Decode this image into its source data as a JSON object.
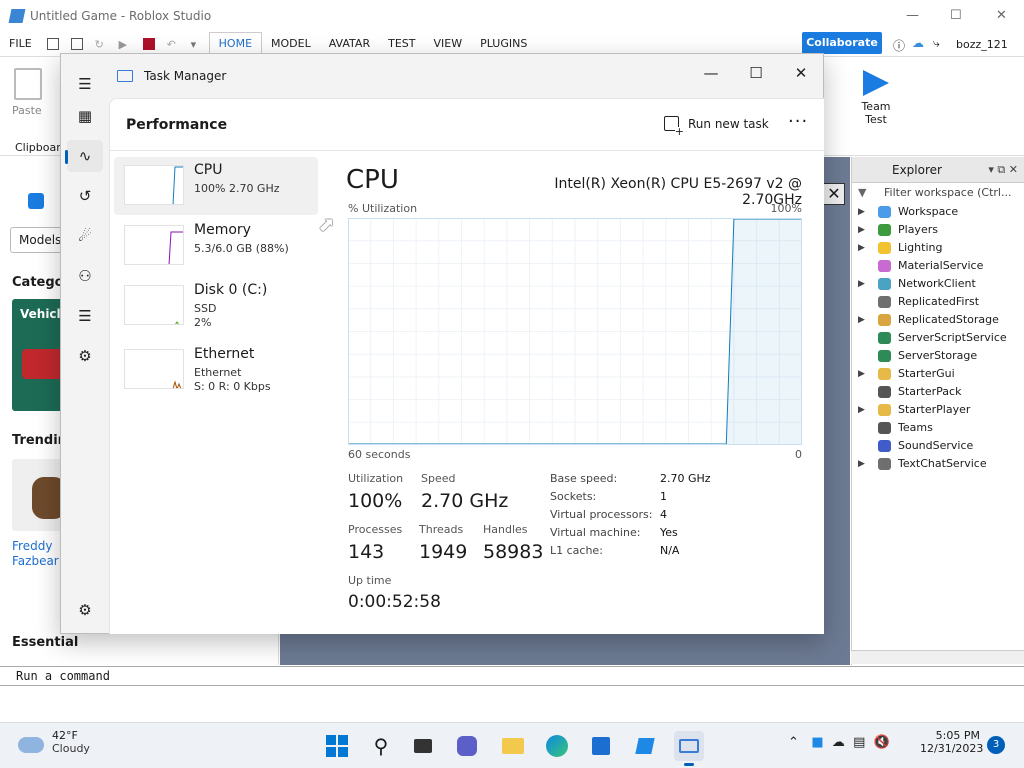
{
  "studio": {
    "title": "Untitled Game - Roblox Studio",
    "menu": [
      "FILE",
      "HOME",
      "MODEL",
      "AVATAR",
      "TEST",
      "VIEW",
      "PLUGINS"
    ],
    "collaborate": "Collaborate",
    "username": "bozz_121",
    "paste": "Paste",
    "clipboard": "Clipboar",
    "team_test": "Team Test",
    "left_panel": {
      "models_tab": "Models",
      "categories": "Categor",
      "vehicle": "Vehicl",
      "trending": "Trendin",
      "item_name": "Freddy Fazbear",
      "essential": "Essential"
    },
    "command_bar_placeholder": "Run a command",
    "explorer": {
      "title": "Explorer",
      "filter_placeholder": "Filter workspace (Ctrl...",
      "items": [
        {
          "label": "Workspace",
          "expandable": true,
          "color": "#4c9be8"
        },
        {
          "label": "Players",
          "expandable": true,
          "color": "#3d9a3d"
        },
        {
          "label": "Lighting",
          "expandable": true,
          "color": "#f2c230"
        },
        {
          "label": "MaterialService",
          "expandable": false,
          "color": "#c86bd1"
        },
        {
          "label": "NetworkClient",
          "expandable": true,
          "color": "#4aa3c2"
        },
        {
          "label": "ReplicatedFirst",
          "expandable": false,
          "color": "#6f6f6f"
        },
        {
          "label": "ReplicatedStorage",
          "expandable": true,
          "color": "#d9a441"
        },
        {
          "label": "ServerScriptService",
          "expandable": false,
          "color": "#2e8b57"
        },
        {
          "label": "ServerStorage",
          "expandable": false,
          "color": "#2e8b57"
        },
        {
          "label": "StarterGui",
          "expandable": true,
          "color": "#e7b949"
        },
        {
          "label": "StarterPack",
          "expandable": false,
          "color": "#555555"
        },
        {
          "label": "StarterPlayer",
          "expandable": true,
          "color": "#e7b949"
        },
        {
          "label": "Teams",
          "expandable": false,
          "color": "#555555"
        },
        {
          "label": "SoundService",
          "expandable": false,
          "color": "#3f5cc9"
        },
        {
          "label": "TextChatService",
          "expandable": true,
          "color": "#6f6f6f"
        }
      ]
    }
  },
  "task_manager": {
    "title": "Task Manager",
    "page": "Performance",
    "run_new_task": "Run new task",
    "more": "···",
    "sidebar": [
      {
        "name": "CPU",
        "line1": "100%  2.70 GHz",
        "line2": ""
      },
      {
        "name": "Memory",
        "line1": "5.3/6.0 GB (88%)",
        "line2": ""
      },
      {
        "name": "Disk 0 (C:)",
        "line1": "SSD",
        "line2": "2%"
      },
      {
        "name": "Ethernet",
        "line1": "Ethernet",
        "line2": "S: 0  R: 0 Kbps"
      }
    ],
    "detail": {
      "heading": "CPU",
      "model": "Intel(R) Xeon(R) CPU E5-2697 v2 @ 2.70GHz",
      "graph_label": "% Utilization",
      "graph_max": "100%",
      "graph_span": "60 seconds",
      "graph_min": "0",
      "utilization_label": "Utilization",
      "utilization": "100%",
      "speed_label": "Speed",
      "speed": "2.70 GHz",
      "processes_label": "Processes",
      "processes": "143",
      "threads_label": "Threads",
      "threads": "1949",
      "handles_label": "Handles",
      "handles": "58983",
      "uptime_label": "Up time",
      "uptime": "0:00:52:58",
      "props": [
        {
          "label": "Base speed:",
          "value": "2.70 GHz"
        },
        {
          "label": "Sockets:",
          "value": "1"
        },
        {
          "label": "Virtual processors:",
          "value": "4"
        },
        {
          "label": "Virtual machine:",
          "value": "Yes"
        },
        {
          "label": "L1 cache:",
          "value": "N/A"
        }
      ]
    },
    "colors": {
      "cpu": "#117dbb",
      "memory": "#8b12ae",
      "accent": "#005fb8"
    },
    "cpu_history_percent": [
      0,
      0,
      0,
      0,
      0,
      0,
      0,
      0,
      0,
      0,
      0,
      0,
      0,
      0,
      0,
      0,
      0,
      0,
      0,
      0,
      0,
      0,
      0,
      0,
      0,
      0,
      0,
      0,
      0,
      0,
      0,
      0,
      0,
      0,
      0,
      0,
      0,
      0,
      0,
      0,
      0,
      0,
      0,
      0,
      0,
      0,
      0,
      0,
      0,
      0,
      0,
      100,
      100,
      100,
      100,
      100,
      100,
      100,
      100,
      100,
      100
    ]
  },
  "taskbar": {
    "weather_temp": "42°F",
    "weather_desc": "Cloudy",
    "time": "5:05 PM",
    "date": "12/31/2023",
    "notifications": "3"
  }
}
